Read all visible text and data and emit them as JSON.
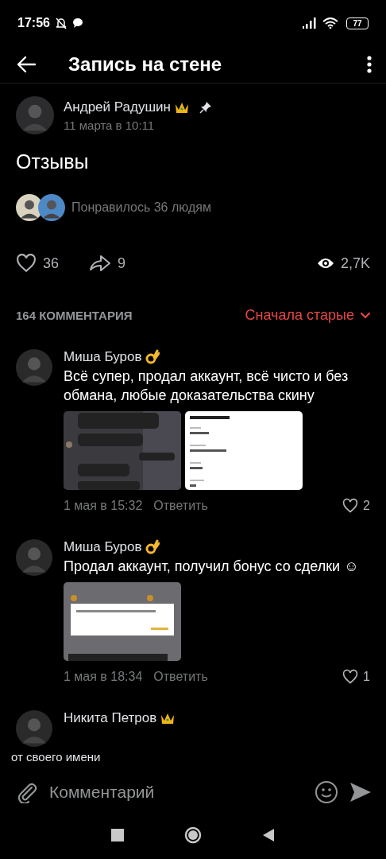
{
  "status_bar": {
    "time": "17:56",
    "battery": "77"
  },
  "header": {
    "title": "Запись на стене"
  },
  "post": {
    "author": "Андрей Радушин",
    "kind": "crown",
    "pinned": true,
    "date": "11 марта в 10:11",
    "text": "Отзывы",
    "liked_by": "Понравилось 36 людям",
    "likes": "36",
    "liked": false,
    "shares": "9",
    "views": "2,7K"
  },
  "comments": {
    "count_label": "164 КОММЕНТАРИЯ",
    "sort": "Сначала старые",
    "items": [
      {
        "author": "Миша Буров",
        "kind": "ok",
        "text": "Всё супер, продал аккаунт, всё чисто и без обмана, любые доказательства скину",
        "attachments": [
          {
            "kind": "chat"
          },
          {
            "kind": "receipt"
          }
        ],
        "date": "1 мая в 15:32",
        "reply": "Ответить",
        "likes": "2",
        "liked": false
      },
      {
        "author": "Миша Буров",
        "kind": "ok",
        "text": "Продал аккаунт, получил бонус со сделки ☺",
        "attachments": [
          {
            "kind": "dialog"
          }
        ],
        "date": "1 мая в 18:34",
        "reply": "Ответить",
        "likes": "1",
        "liked": false
      },
      {
        "author": "Никита Петров",
        "kind": "crown"
      }
    ]
  },
  "hint": "от своего имени",
  "composer": {
    "placeholder": "Комментарий"
  }
}
